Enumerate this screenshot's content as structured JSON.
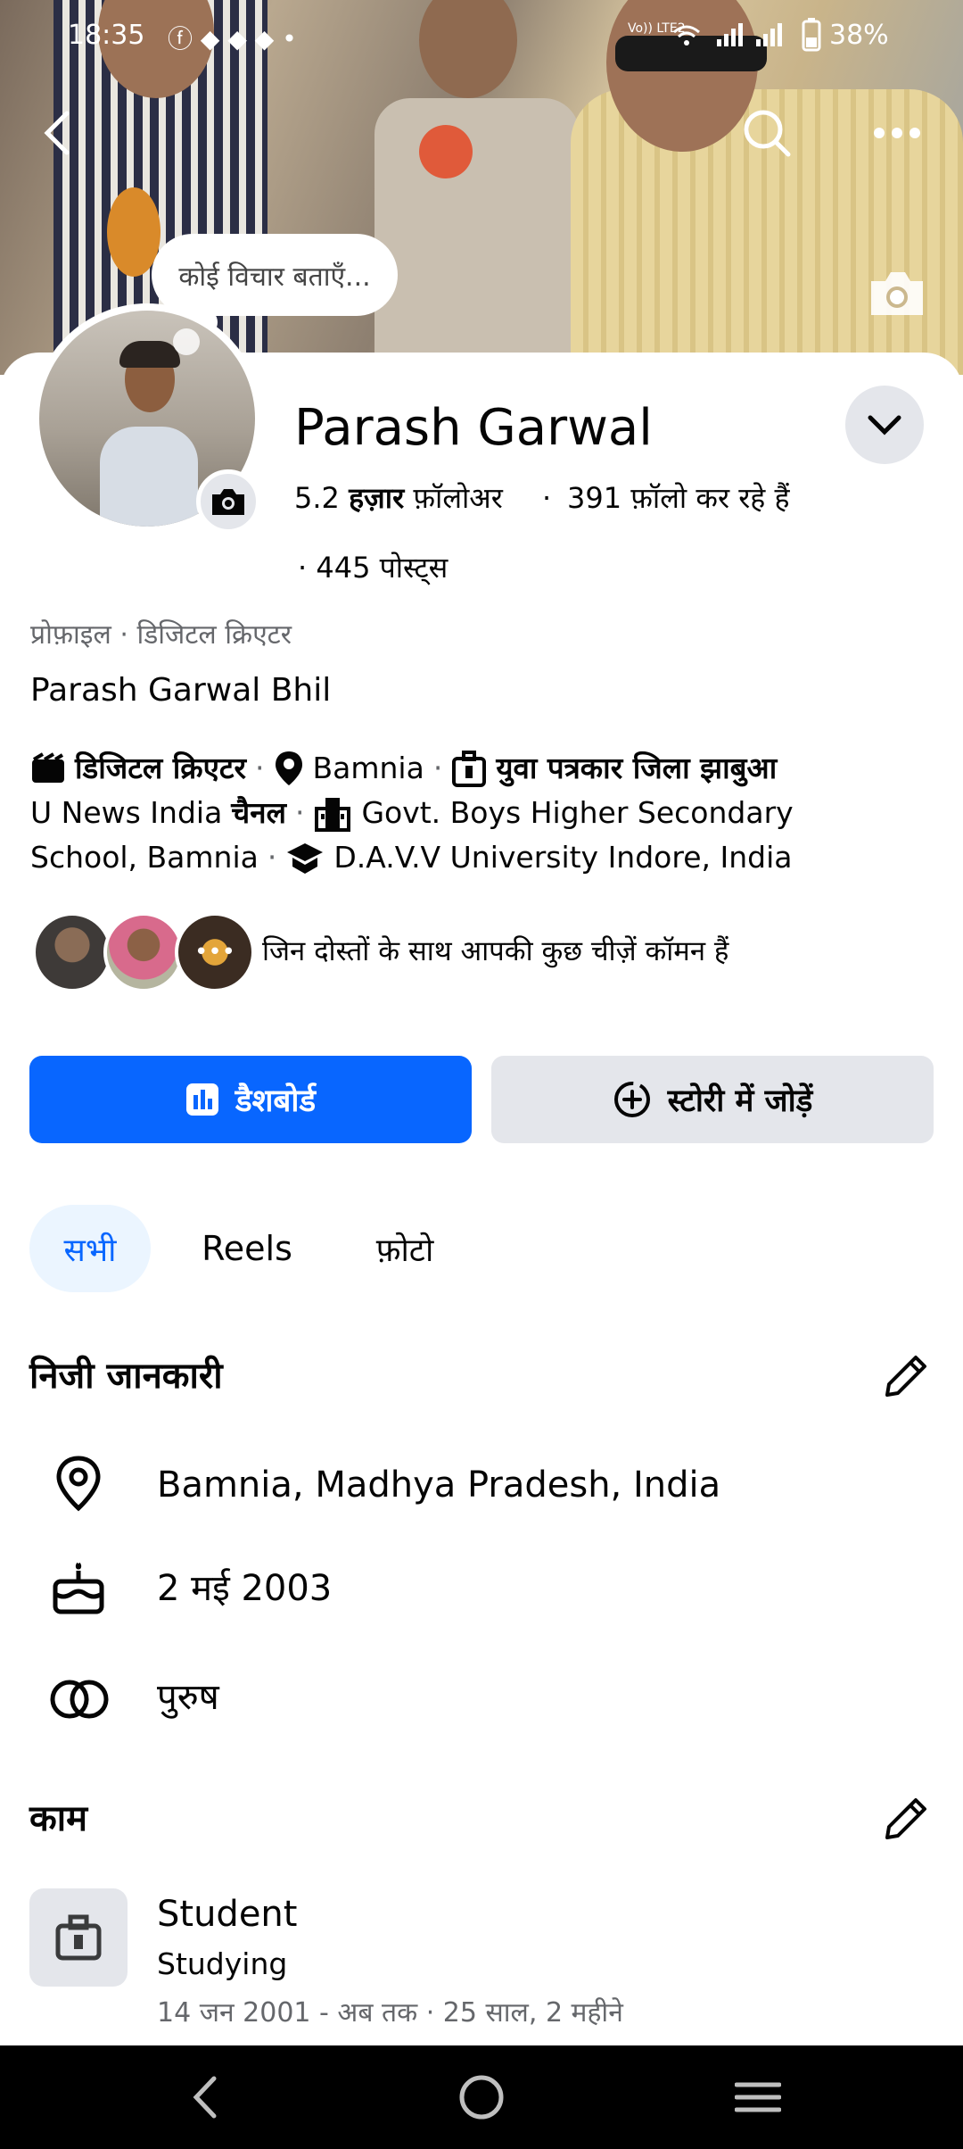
{
  "status_bar": {
    "time": "18:35",
    "network_label": "Vo)) LTE2",
    "battery": "38%"
  },
  "cover": {
    "thought_bubble": "कोई विचार बताएँ..."
  },
  "profile": {
    "name": "Parash Garwal",
    "followers_count": "5.2",
    "followers_unit": "हज़ार",
    "followers_label": "फ़ॉलोअर",
    "following_count": "391",
    "following_label": "फ़ॉलो कर रहे हैं",
    "posts_count": "445",
    "posts_label": "पोस्ट्स",
    "category_prefix": "प्रोफ़ाइल",
    "category": "डिजिटल क्रिएटर",
    "bio": "Parash Garwal Bhil"
  },
  "details": {
    "category": "डिजिटल क्रिएटर",
    "location": "Bamnia",
    "job_title": "युवा पत्रकार जिला झाबुआ",
    "job_line2_a": "U News India",
    "job_line2_b": "चैनल",
    "school_line1": "Govt. Boys Higher Secondary",
    "school_line2": "School, Bamnia",
    "university": "D.A.V.V University Indore, India"
  },
  "mutual": {
    "text": "जिन दोस्तों के साथ आपकी कुछ चीज़ें कॉमन हैं"
  },
  "actions": {
    "dashboard": "डैशबोर्ड",
    "add_story": "स्टोरी में जोड़ें"
  },
  "tabs": [
    {
      "label": "सभी",
      "active": true
    },
    {
      "label": "Reels",
      "active": false
    },
    {
      "label": "फ़ोटो",
      "active": false
    }
  ],
  "personal": {
    "title": "निजी जानकारी",
    "location": "Bamnia, Madhya Pradesh, India",
    "birthday": "2 मई 2003",
    "gender": "पुरुष"
  },
  "work": {
    "title": "काम",
    "role": "Student",
    "place": "Studying",
    "dates": "14 जन 2001 - अब तक",
    "duration": "25 साल, 2 महीने"
  },
  "colors": {
    "accent": "#0866FF",
    "secondary_bg": "#E4E6EB",
    "active_tab_bg": "#EBF5FF"
  },
  "icons": [
    "back-icon",
    "search-icon",
    "more-icon",
    "camera-icon",
    "chevron-down-icon",
    "clapper-icon",
    "location-icon",
    "briefcase-icon",
    "school-icon",
    "graduation-icon",
    "dashboard-icon",
    "add-story-icon",
    "edit-icon",
    "birthday-icon",
    "gender-icon"
  ]
}
